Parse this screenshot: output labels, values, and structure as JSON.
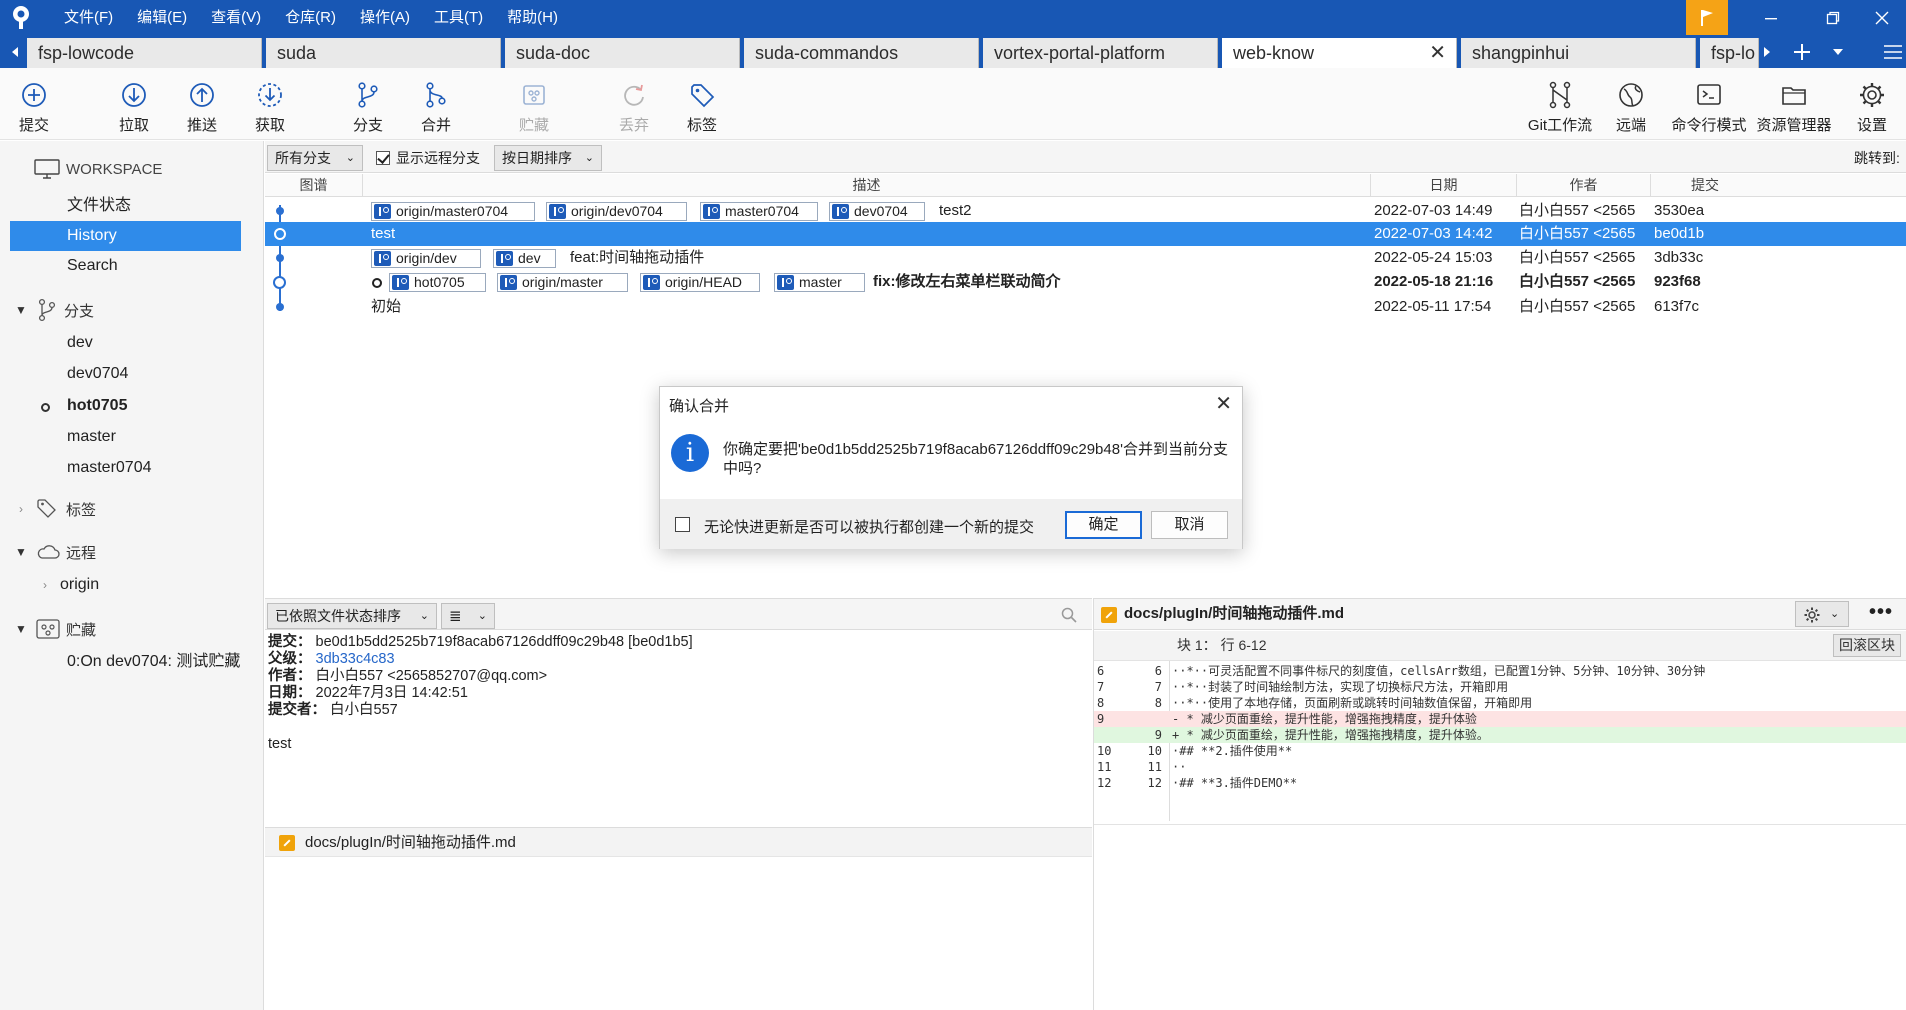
{
  "menu": [
    "文件(F)",
    "编辑(E)",
    "查看(V)",
    "仓库(R)",
    "操作(A)",
    "工具(T)",
    "帮助(H)"
  ],
  "tabs": [
    {
      "label": "fsp-lowcode"
    },
    {
      "label": "suda"
    },
    {
      "label": "suda-doc"
    },
    {
      "label": "suda-commandos"
    },
    {
      "label": "vortex-portal-platform"
    },
    {
      "label": "web-know"
    },
    {
      "label": "shangpinhui"
    },
    {
      "label": "fsp-lo"
    }
  ],
  "active_tab_close": "✕",
  "toolbar": {
    "commit": "提交",
    "pull": "拉取",
    "push": "推送",
    "fetch": "获取",
    "branch": "分支",
    "merge": "合并",
    "stash": "贮藏",
    "discard": "丢弃",
    "tag": "标签",
    "git_flow": "Git工作流",
    "remote": "远端",
    "terminal": "命令行模式",
    "explorer": "资源管理器",
    "settings": "设置"
  },
  "sidebar": {
    "workspace": "WORKSPACE",
    "workspace_items": [
      "文件状态",
      "History",
      "Search"
    ],
    "branches_label": "分支",
    "branches": [
      "dev",
      "dev0704",
      "hot0705",
      "master",
      "master0704"
    ],
    "tags_label": "标签",
    "remotes_label": "远程",
    "remotes": [
      "origin"
    ],
    "stashes_label": "贮藏",
    "stashes": [
      "0:On dev0704: 测试贮藏"
    ]
  },
  "filters": {
    "branches": "所有分支",
    "show_remote": "显示远程分支",
    "sort": "按日期排序",
    "jump_to": "跳转到:"
  },
  "history_columns": {
    "graph": "图谱",
    "desc": "描述",
    "date": "日期",
    "author": "作者",
    "commit": "提交"
  },
  "commits": [
    {
      "refs": [
        "origin/master0704",
        "origin/dev0704",
        "master0704",
        "dev0704"
      ],
      "message": "test2",
      "date": "2022-07-03 14:49",
      "author": "白小白557 <2565",
      "hash": "3530ea"
    },
    {
      "refs": [],
      "message": "test",
      "date": "2022-07-03 14:42",
      "author": "白小白557 <2565",
      "hash": "be0d1b"
    },
    {
      "refs": [
        "origin/dev",
        "dev"
      ],
      "message": "feat:时间轴拖动插件",
      "date": "2022-05-24 15:03",
      "author": "白小白557 <2565",
      "hash": "3db33c"
    },
    {
      "refs": [
        "hot0705",
        "origin/master",
        "origin/HEAD",
        "master"
      ],
      "message": "fix:修改左右菜单栏联动简介",
      "date": "2022-05-18 21:16",
      "author": "白小白557 <2565",
      "hash": "923f68"
    },
    {
      "refs": [],
      "message": "初始",
      "date": "2022-05-11 17:54",
      "author": "白小白557 <2565",
      "hash": "613f7c"
    }
  ],
  "lower": {
    "sort_label": "已依照文件状态排序",
    "list_icon": "≣"
  },
  "details": {
    "commit_k": "提交：",
    "commit_v": "be0d1b5dd2525b719f8acab67126ddff09c29b48 [be0d1b5]",
    "parent_k": "父级：",
    "parent_v": "3db33c4c83",
    "author_k": "作者：",
    "author_v": "白小白557 <2565852707@qq.com>",
    "date_k": "日期：",
    "date_v": "2022年7月3日 14:42:51",
    "committer_k": "提交者：",
    "committer_v": "白小白557",
    "message": "test"
  },
  "file_path": "docs/plugIn/时间轴拖动插件.md",
  "diff": {
    "hunk": "块 1：  行 6-12",
    "revert_label": "回滚区块",
    "lines": [
      {
        "n1": "6",
        "n2": "6",
        "type": "ctx",
        "code": "··*··可灵活配置不同事件标尺的刻度值，cellsArr数组，已配置1分钟、5分钟、10分钟、30分钟"
      },
      {
        "n1": "7",
        "n2": "7",
        "type": "ctx",
        "code": "··*··封装了时间轴绘制方法，实现了切换标尺方法，开箱即用"
      },
      {
        "n1": "8",
        "n2": "8",
        "type": "ctx",
        "code": "··*··使用了本地存储，页面刷新或跳转时间轴数值保留，开箱即用"
      },
      {
        "n1": "9",
        "n2": "",
        "type": "del",
        "code": "- * 减少页面重绘，提升性能，增强拖拽精度，提升体验"
      },
      {
        "n1": "",
        "n2": "9",
        "type": "add",
        "code": "+ * 减少页面重绘，提升性能，增强拖拽精度，提升体验。"
      },
      {
        "n1": "10",
        "n2": "10",
        "type": "ctx",
        "code": "·## **2.插件使用**"
      },
      {
        "n1": "11",
        "n2": "11",
        "type": "ctx",
        "code": "··"
      },
      {
        "n1": "12",
        "n2": "12",
        "type": "ctx",
        "code": "·## **3.插件DEMO**"
      }
    ]
  },
  "dialog": {
    "title": "确认合并",
    "message": "你确定要把'be0d1b5dd2525b719f8acab67126ddff09c29b48'合并到当前分支中吗?",
    "checkbox_label": "无论快进更新是否可以被执行都创建一个新的提交",
    "ok": "确定",
    "cancel": "取消"
  },
  "colors": {
    "brand": "#1857b4",
    "selection": "#2f8bea",
    "flag": "#f5a316"
  }
}
